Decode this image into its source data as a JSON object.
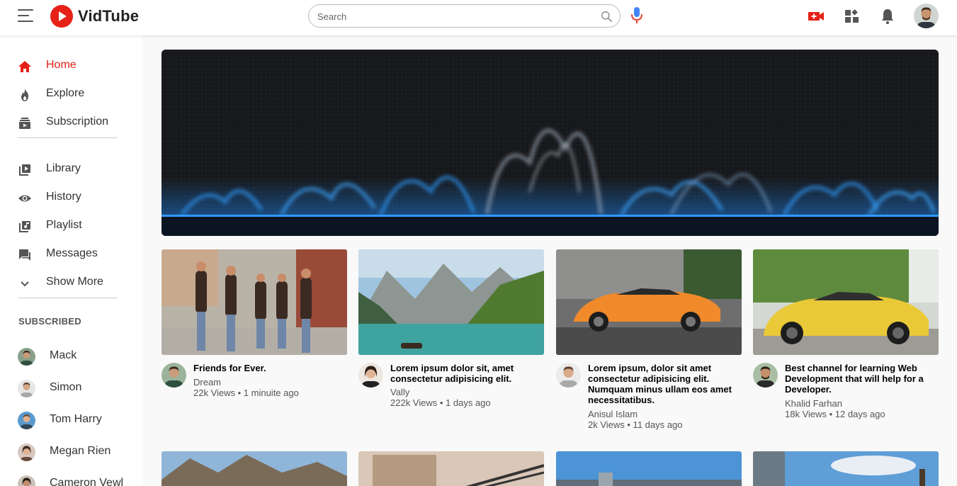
{
  "header": {
    "logo_text": "VidTube",
    "search_placeholder": "Search"
  },
  "sidebar": {
    "nav": [
      {
        "label": "Home",
        "icon": "home-icon",
        "active": true
      },
      {
        "label": "Explore",
        "icon": "flame-icon"
      },
      {
        "label": "Subscription",
        "icon": "subscription-icon"
      },
      {
        "label": "Library",
        "icon": "library-icon"
      },
      {
        "label": "History",
        "icon": "eye-icon"
      },
      {
        "label": "Playlist",
        "icon": "playlist-icon"
      },
      {
        "label": "Messages",
        "icon": "message-icon"
      },
      {
        "label": "Show More",
        "icon": "chevron-down-icon"
      }
    ],
    "subscribed_title": "SUBSCRIBED",
    "subscriptions": [
      {
        "name": "Mack"
      },
      {
        "name": "Simon"
      },
      {
        "name": "Tom Harry"
      },
      {
        "name": "Megan Rien"
      },
      {
        "name": "Cameron Vewl"
      }
    ]
  },
  "videos": [
    {
      "title": "Friends for Ever.",
      "channel": "Dream",
      "stats": "22k Views • 1 minuite ago"
    },
    {
      "title": "Lorem ipsum dolor sit, amet consectetur adipisicing elit.",
      "channel": "Vally",
      "stats": "222k Views • 1 days ago"
    },
    {
      "title": "Lorem ipsum, dolor sit amet consectetur adipisicing elit. Numquam minus ullam eos amet necessitatibus.",
      "channel": "Anisul Islam",
      "stats": "2k Views • 11 days ago"
    },
    {
      "title": "Best channel for learning Web Development that will help for a Developer.",
      "channel": "Khalid Farhan",
      "stats": "18k Views • 12 days ago"
    }
  ],
  "colors": {
    "accent": "#e62117",
    "sidebar_bg": "#ffffff",
    "page_bg": "#f9f9f9"
  }
}
